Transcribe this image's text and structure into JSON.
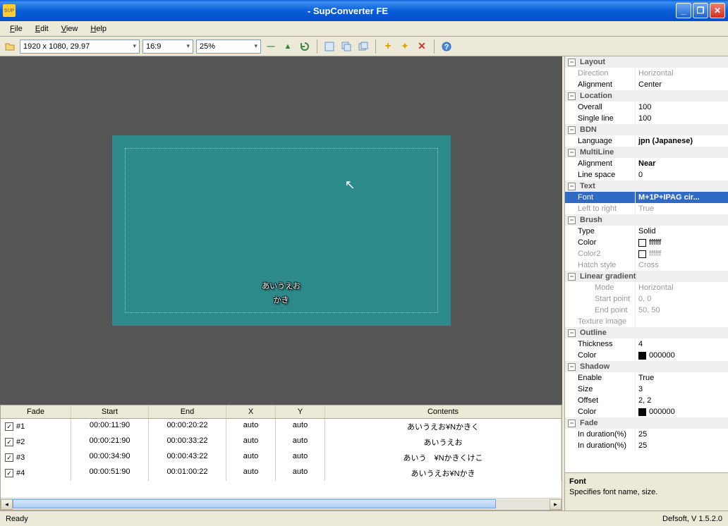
{
  "title": "- SupConverter FE",
  "menu": {
    "file": "File",
    "edit": "Edit",
    "view": "View",
    "help": "Help"
  },
  "toolbar": {
    "resolution": "1920 x 1080, 29.97",
    "aspect": "16:9",
    "zoom": "25%"
  },
  "preview": {
    "line1": "あいうえお",
    "line2": "かき"
  },
  "columns": {
    "fade": "Fade",
    "start": "Start",
    "end": "End",
    "x": "X",
    "y": "Y",
    "contents": "Contents"
  },
  "rows": [
    {
      "id": "#1",
      "start": "00:00:11:90",
      "end": "00:00:20:22",
      "x": "auto",
      "y": "auto",
      "contents": "あいうえお¥Nかきく"
    },
    {
      "id": "#2",
      "start": "00:00:21:90",
      "end": "00:00:33:22",
      "x": "auto",
      "y": "auto",
      "contents": "あいうえお"
    },
    {
      "id": "#3",
      "start": "00:00:34:90",
      "end": "00:00:43:22",
      "x": "auto",
      "y": "auto",
      "contents": "あいう　¥Nかきくけこ"
    },
    {
      "id": "#4",
      "start": "00:00:51:90",
      "end": "00:01:00:22",
      "x": "auto",
      "y": "auto",
      "contents": "あいうえお¥Nかき"
    }
  ],
  "props": {
    "layout": {
      "label": "Layout",
      "direction_k": "Direction",
      "direction_v": "Horizontal",
      "alignment_k": "Alignment",
      "alignment_v": "Center"
    },
    "location": {
      "label": "Location",
      "overall_k": "Overall",
      "overall_v": "100",
      "single_k": "Single line",
      "single_v": "100"
    },
    "bdn": {
      "label": "BDN",
      "lang_k": "Language",
      "lang_v": "jpn (Japanese)"
    },
    "multiline": {
      "label": "MultiLine",
      "align_k": "Alignment",
      "align_v": "Near",
      "space_k": "Line space",
      "space_v": "0"
    },
    "text": {
      "label": "Text",
      "font_k": "Font",
      "font_v": "M+1P+IPAG cir...",
      "ltr_k": "Left to right",
      "ltr_v": "True"
    },
    "brush": {
      "label": "Brush",
      "type_k": "Type",
      "type_v": "Solid",
      "color_k": "Color",
      "color_v": "ffffff",
      "color2_k": "Color2",
      "color2_v": "ffffff",
      "hatch_k": "Hatch style",
      "hatch_v": "Cross",
      "lg": {
        "label": "Linear gradient",
        "mode_k": "Mode",
        "mode_v": "Horizontal",
        "start_k": "Start point",
        "start_v": "0, 0",
        "end_k": "End point",
        "end_v": "50, 50"
      },
      "tex_k": "Texture image",
      "tex_v": ""
    },
    "outline": {
      "label": "Outline",
      "thick_k": "Thickness",
      "thick_v": "4",
      "color_k": "Color",
      "color_v": "000000"
    },
    "shadow": {
      "label": "Shadow",
      "enable_k": "Enable",
      "enable_v": "True",
      "size_k": "Size",
      "size_v": "3",
      "offset_k": "Offset",
      "offset_v": "2, 2",
      "color_k": "Color",
      "color_v": "000000"
    },
    "fade": {
      "label": "Fade",
      "in_k": "In duration(%)",
      "in_v": "25",
      "out_k": "In duration(%)",
      "out_v": "25"
    }
  },
  "desc": {
    "title": "Font",
    "text": "Specifies font name, size."
  },
  "status": {
    "ready": "Ready",
    "version": "Defsoft, V 1.5.2.0"
  }
}
